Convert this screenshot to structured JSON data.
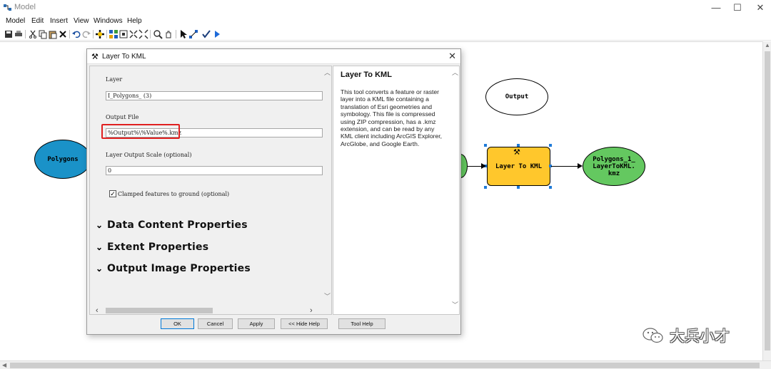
{
  "window": {
    "title": "Model",
    "controls": {
      "minimize": "—",
      "maximize": "☐",
      "close": "✕"
    }
  },
  "menu": [
    "Model",
    "Edit",
    "Insert",
    "View",
    "Windows",
    "Help"
  ],
  "toolbar_icons": [
    "save-icon",
    "print-icon",
    "cut-icon",
    "copy-icon",
    "paste-icon",
    "delete-icon",
    "undo-icon",
    "redo-icon",
    "add-data-icon",
    "auto-layout-icon",
    "full-extent-icon",
    "fixed-zoom-in-icon",
    "fixed-zoom-out-icon",
    "zoom-icon",
    "pan-icon",
    "select-icon",
    "connect-icon",
    "validate-icon",
    "run-icon"
  ],
  "diagram": {
    "input_node": "Polygons",
    "tool_node": "Layer To KML",
    "output_node": "Polygons_1_ LayerToKML. kmz",
    "variable_node": "Output"
  },
  "dialog": {
    "title": "Layer To KML",
    "params": {
      "layer_label": "Layer",
      "layer_value": "I_Polygons_ (3)",
      "output_label": "Output File",
      "output_value": "%Output%\\%Value%.kmz",
      "scale_label": "Layer Output Scale (optional)",
      "scale_value": "0",
      "clamp_label": "Clamped features to ground (optional)",
      "clamp_checked": true
    },
    "sections": [
      "Data Content Properties",
      "Extent Properties",
      "Output Image Properties"
    ],
    "help": {
      "title": "Layer To KML",
      "body": "This tool converts a feature or raster layer into a KML file containing a translation of Esri geometries and symbology. This file is compressed using ZIP compression, has a .kmz extension, and can be read by any KML client including ArcGIS Explorer, ArcGlobe, and Google Earth."
    },
    "buttons": {
      "ok": "OK",
      "cancel": "Cancel",
      "apply": "Apply",
      "hide_help": "<< Hide Help",
      "tool_help": "Tool Help"
    }
  },
  "watermark": {
    "text": "大兵小才"
  },
  "colors": {
    "input_fill": "#1a92c8",
    "tool_fill": "#ffc72c",
    "output_fill": "#64c860",
    "selection": "#1e7ad8",
    "highlight": "#e02020"
  }
}
